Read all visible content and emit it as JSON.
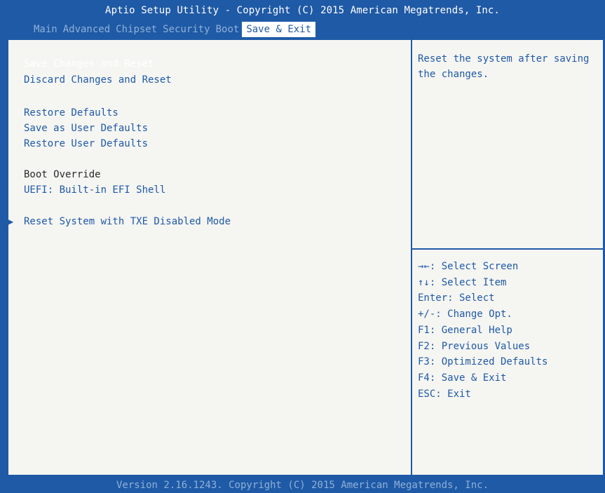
{
  "title": "Aptio Setup Utility - Copyright (C) 2015 American Megatrends, Inc.",
  "tabs": [
    {
      "label": "Main"
    },
    {
      "label": "Advanced"
    },
    {
      "label": "Chipset"
    },
    {
      "label": "Security"
    },
    {
      "label": "Boot"
    },
    {
      "label": "Save & Exit",
      "active": true
    }
  ],
  "menu": {
    "save_changes_reset": "Save Changes and Reset",
    "discard_changes_reset": "Discard Changes and Reset",
    "restore_defaults": "Restore Defaults",
    "save_user_defaults": "Save as User Defaults",
    "restore_user_defaults": "Restore User Defaults",
    "boot_override_label": "Boot Override",
    "uefi_shell": "UEFI: Built-in EFI Shell",
    "reset_txe": "Reset System with TXE Disabled Mode"
  },
  "help_text": "Reset the system after saving the changes.",
  "keys": [
    "→←: Select Screen",
    "↑↓: Select Item",
    "Enter: Select",
    "+/-: Change Opt.",
    "F1: General Help",
    "F2: Previous Values",
    "F3: Optimized Defaults",
    "F4: Save & Exit",
    "ESC: Exit"
  ],
  "footer": "Version 2.16.1243. Copyright (C) 2015 American Megatrends, Inc.",
  "colors": {
    "bios_blue": "#1f5aa6",
    "panel_bg": "#f5f5f2",
    "selected_text": "#ffffff",
    "inactive_tab_text": "#8fb0d8"
  }
}
